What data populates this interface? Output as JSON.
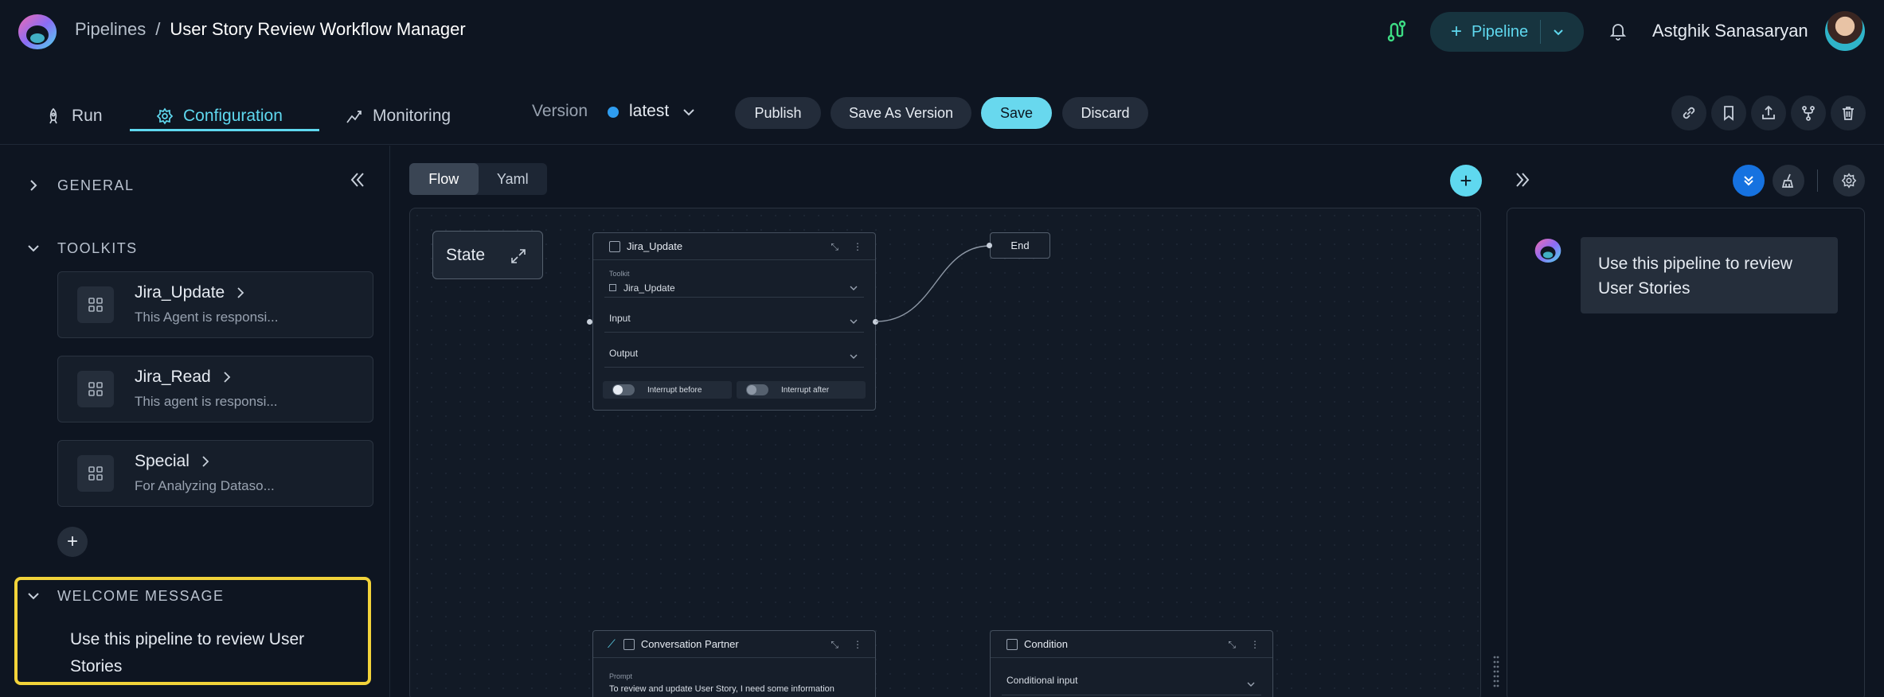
{
  "breadcrumb": {
    "parent": "Pipelines",
    "separator": "/",
    "current": "User Story Review Workflow Manager"
  },
  "header": {
    "pipeline_button": "Pipeline",
    "user_name": "Astghik Sanasaryan"
  },
  "tabs": {
    "run": "Run",
    "configuration": "Configuration",
    "monitoring": "Monitoring"
  },
  "version": {
    "label": "Version",
    "value": "latest"
  },
  "actions": {
    "publish": "Publish",
    "save_as_version": "Save As Version",
    "save": "Save",
    "discard": "Discard"
  },
  "sidebar": {
    "general_title": "GENERAL",
    "toolkits_title": "TOOLKITS",
    "toolkits": [
      {
        "name": "Jira_Update",
        "description": "This Agent is responsi..."
      },
      {
        "name": "Jira_Read",
        "description": "This agent is responsi..."
      },
      {
        "name": "Special",
        "description": "For Analyzing Dataso..."
      }
    ],
    "add_label": "+",
    "welcome_title": "WELCOME MESSAGE",
    "welcome_text": "Use this pipeline to review User Stories"
  },
  "canvas": {
    "view_flow": "Flow",
    "view_yaml": "Yaml",
    "add_node_label": "+",
    "state_node": "State",
    "jira_node": {
      "title": "Jira_Update",
      "toolkit_label": "Toolkit",
      "toolkit_value": "Jira_Update",
      "input_label": "Input",
      "output_label": "Output",
      "interrupt_before": "Interrupt before",
      "interrupt_after": "Interrupt after"
    },
    "end_node": "End",
    "conversation_node": {
      "title": "Conversation Partner",
      "prompt_label": "Prompt",
      "prompt_text": "To review and update User Story, I need some information"
    },
    "condition_node": {
      "title": "Condition",
      "input_label": "Conditional input"
    }
  },
  "chat": {
    "message": "Use this pipeline to review User Stories"
  },
  "colors": {
    "accent": "#5fd8ef",
    "highlight": "#f2d33a",
    "background": "#0e1521"
  }
}
